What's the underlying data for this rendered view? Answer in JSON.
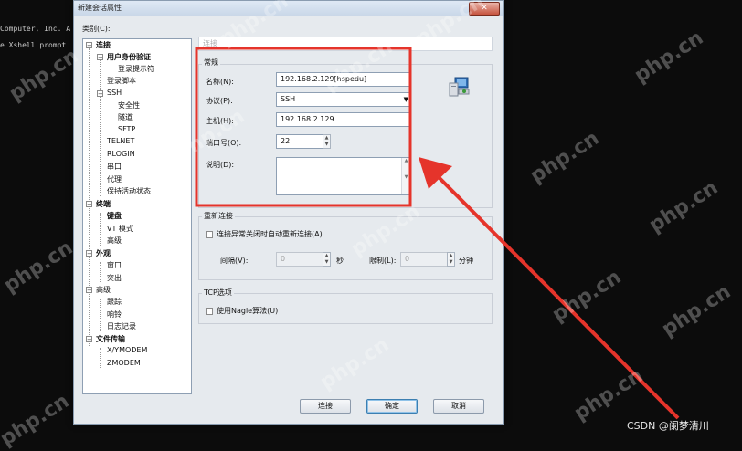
{
  "terminal": {
    "lines": [
      "Computer, Inc. A",
      "e Xshell prompt"
    ]
  },
  "dialog": {
    "title": "新建会话属性",
    "close_label": "✕",
    "category_label": "类别(C):",
    "tree": [
      {
        "label": "连接"
      },
      {
        "label": "用户身份验证"
      },
      {
        "label": "登录提示符"
      },
      {
        "label": "登录脚本"
      },
      {
        "label": "SSH"
      },
      {
        "label": "安全性"
      },
      {
        "label": "隧道"
      },
      {
        "label": "SFTP"
      },
      {
        "label": "TELNET"
      },
      {
        "label": "RLOGIN"
      },
      {
        "label": "串口"
      },
      {
        "label": "代理"
      },
      {
        "label": "保持活动状态"
      },
      {
        "label": "终端"
      },
      {
        "label": "键盘"
      },
      {
        "label": "VT 模式"
      },
      {
        "label": "高级"
      },
      {
        "label": "外观"
      },
      {
        "label": "窗口"
      },
      {
        "label": "突出"
      },
      {
        "label": "高级"
      },
      {
        "label": "跟踪"
      },
      {
        "label": "响铃"
      },
      {
        "label": "日志记录"
      },
      {
        "label": "文件传输"
      },
      {
        "label": "X/YMODEM"
      },
      {
        "label": "ZMODEM"
      }
    ],
    "header_text": "连接",
    "general": {
      "title": "常规",
      "name_label": "名称(N):",
      "name_value": "192.168.2.129[hspedu]",
      "protocol_label": "协议(P):",
      "protocol_value": "SSH",
      "host_label": "主机(H):",
      "host_value": "192.168.2.129",
      "port_label": "端口号(O):",
      "port_value": "22",
      "desc_label": "说明(D):",
      "desc_value": ""
    },
    "reconnect": {
      "title": "重新连接",
      "checkbox_label": "连接异常关闭时自动重新连接(A)",
      "interval_label": "间隔(V):",
      "interval_value": "0",
      "interval_unit": "秒",
      "limit_label": "限制(L):",
      "limit_value": "0",
      "limit_unit": "分钟"
    },
    "tcp": {
      "title": "TCP选项",
      "checkbox_label": "使用Nagle算法(U)"
    },
    "buttons": {
      "connect": "连接",
      "ok": "确定",
      "cancel": "取消"
    }
  },
  "annotation": {
    "highlight_color": "#e5342b"
  },
  "watermark_text": "php.cn",
  "credit": "CSDN @阑梦清川"
}
